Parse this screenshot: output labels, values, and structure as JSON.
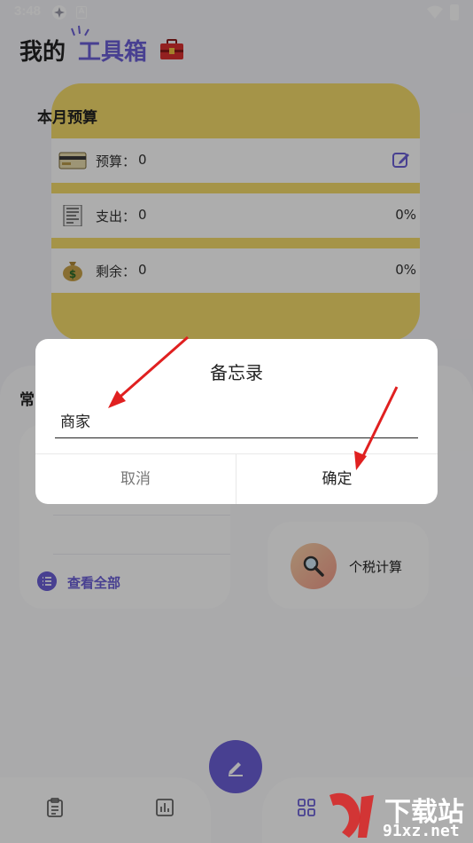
{
  "status_bar": {
    "time": "3:48",
    "icon_a": "pinwheel-icon",
    "icon_b_letter": "A"
  },
  "header": {
    "title_prefix": "我的",
    "title_accent": "工具箱",
    "toolbox_icon": "toolbox-icon"
  },
  "budget": {
    "title": "本月预算",
    "rows": [
      {
        "icon": "card-icon",
        "label": "预算：",
        "value": "0",
        "edit_icon": "edit-icon"
      },
      {
        "icon": "receipt-icon",
        "label": "支出：",
        "value": "0",
        "pct": "0%"
      },
      {
        "icon": "money-bag-icon",
        "label": "剩余：",
        "value": "0",
        "pct": "0%"
      }
    ]
  },
  "lower": {
    "section_label": "常",
    "view_all": "查看全部",
    "tax_label": "个税计算"
  },
  "dialog": {
    "title": "备忘录",
    "input_value": "商家",
    "cancel": "取消",
    "ok": "确定"
  },
  "watermark": {
    "big": "下载站",
    "small": "91xz.net"
  },
  "colors": {
    "accent": "#6a5fd6",
    "budget_bg": "#f3da6a",
    "arrow": "#e02020"
  }
}
